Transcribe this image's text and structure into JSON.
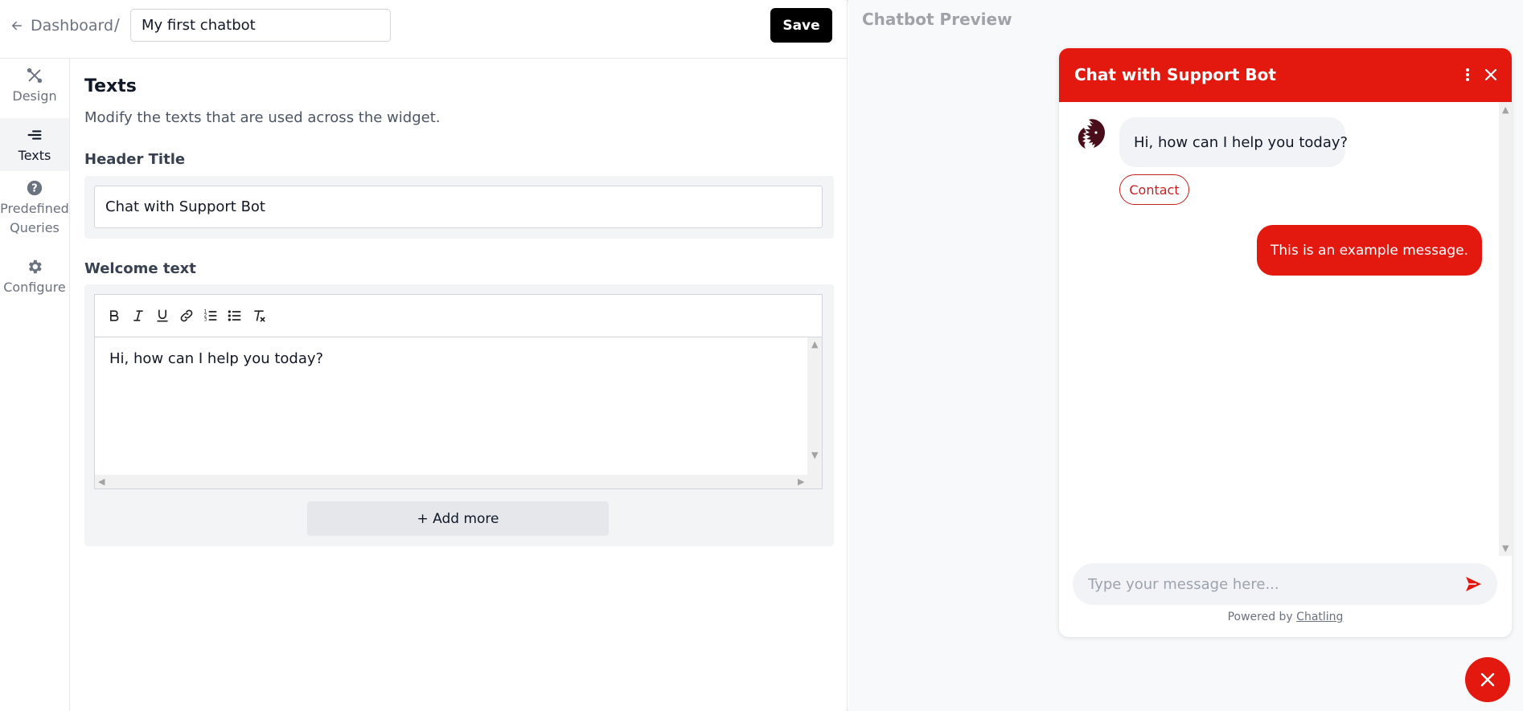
{
  "topbar": {
    "back_label": "Dashboard",
    "separator": "/",
    "chatbot_name": "My first chatbot",
    "save_label": "Save"
  },
  "sidebar": {
    "items": [
      {
        "label": "Design",
        "icon": "design-icon",
        "active": false
      },
      {
        "label": "Texts",
        "icon": "texts-icon",
        "active": true
      },
      {
        "label": "Predefined Queries",
        "icon": "question-icon",
        "active": false
      },
      {
        "label": "Configure",
        "icon": "gear-icon",
        "active": false
      }
    ]
  },
  "texts_section": {
    "title": "Texts",
    "description": "Modify the texts that are used across the widget.",
    "header_title_label": "Header Title",
    "header_title_value": "Chat with Support Bot",
    "welcome_label": "Welcome text",
    "welcome_value": "Hi, how can I help you today?",
    "toolbar_tools": [
      "bold-icon",
      "italic-icon",
      "underline-icon",
      "link-icon",
      "ordered-list-icon",
      "bullet-list-icon",
      "clear-format-icon"
    ],
    "add_more_label": "+ Add more"
  },
  "preview": {
    "title": "Chatbot Preview",
    "header_title": "Chat with Support Bot",
    "bot_message": "Hi, how can I help you today?",
    "contact_label": "Contact",
    "user_message": "This is an example message.",
    "input_placeholder": "Type your message here...",
    "powered_prefix": "Powered by",
    "powered_brand": "Chatling",
    "accent_color": "#e3180f"
  }
}
